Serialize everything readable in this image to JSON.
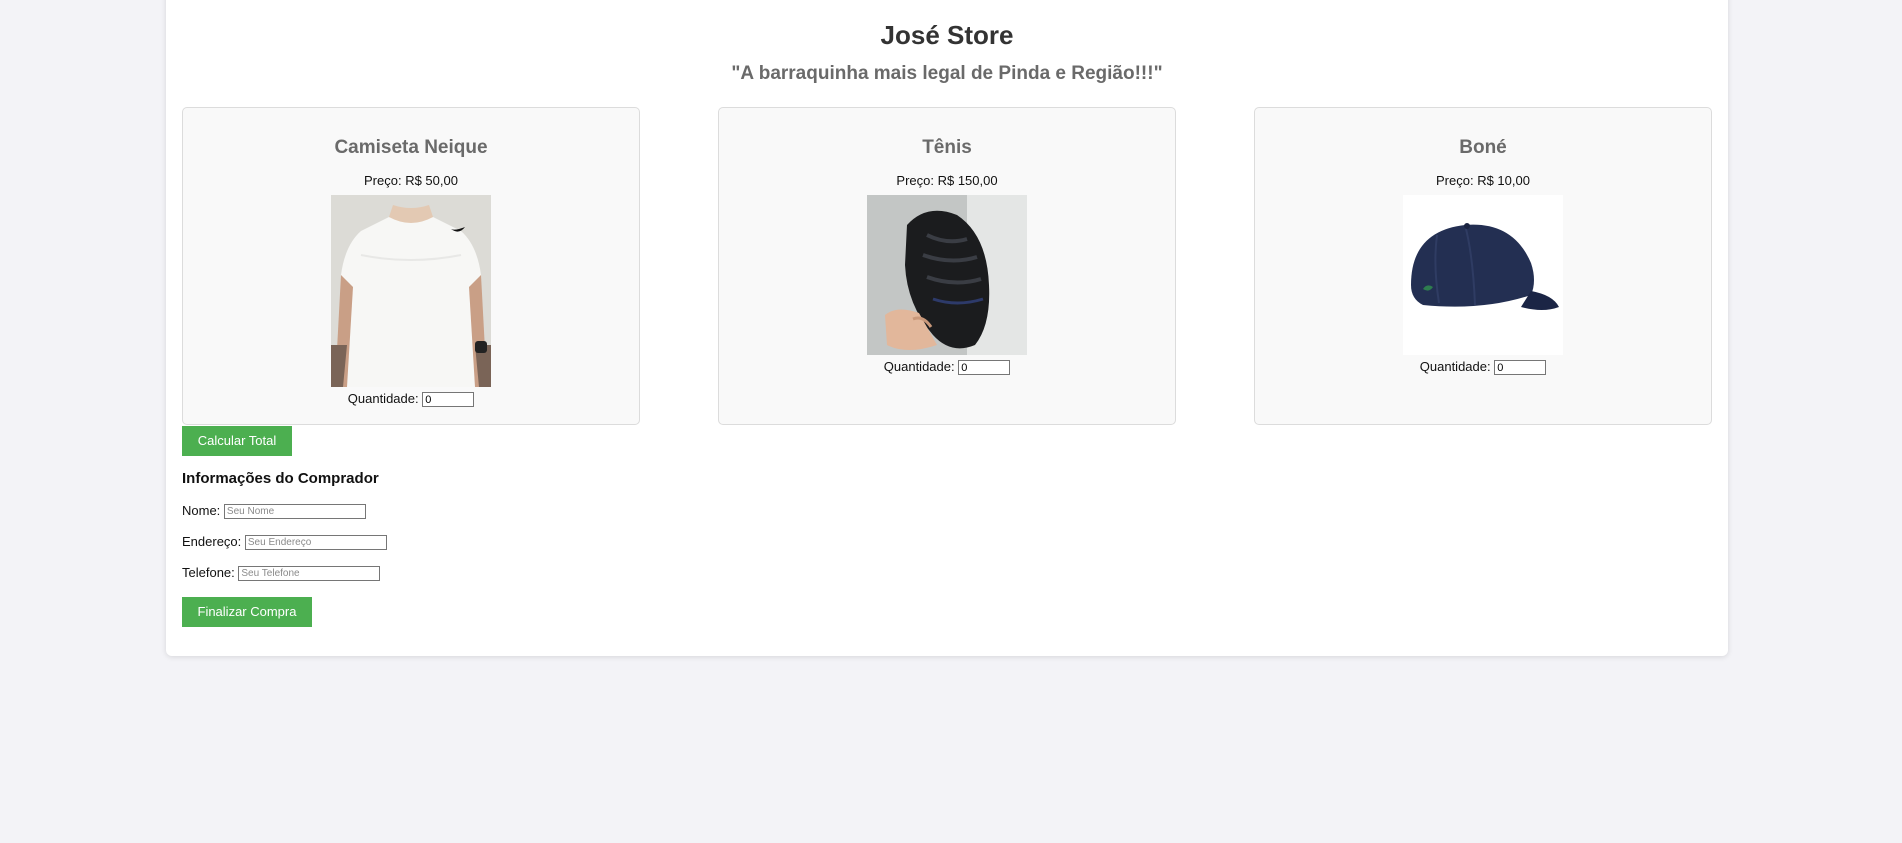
{
  "store": {
    "title": "José Store",
    "slogan": "\"A barraquinha mais legal de Pinda e Região!!!\""
  },
  "products": [
    {
      "name": "Camiseta Neique",
      "price": "Preço: R$ 50,00",
      "image_icon": "white-tshirt-photo",
      "quantity_label": "Quantidade:",
      "quantity_value": "0"
    },
    {
      "name": "Tênis",
      "price": "Preço: R$ 150,00",
      "image_icon": "black-sneaker-photo",
      "quantity_label": "Quantidade:",
      "quantity_value": "0"
    },
    {
      "name": "Boné",
      "price": "Preço: R$ 10,00",
      "image_icon": "navy-cap-photo",
      "quantity_label": "Quantidade:",
      "quantity_value": "0"
    }
  ],
  "actions": {
    "calculate_label": "Calcular Total",
    "finish_label": "Finalizar Compra"
  },
  "buyer": {
    "title": "Informações do Comprador",
    "name_label": "Nome:",
    "name_placeholder": "Seu Nome",
    "address_label": "Endereço:",
    "address_placeholder": "Seu Endereço",
    "phone_label": "Telefone:",
    "phone_placeholder": "Seu Telefone"
  },
  "colors": {
    "page_background": "#f3f3f7",
    "button_green": "#4caf50",
    "card_background": "#f9f9f9"
  }
}
